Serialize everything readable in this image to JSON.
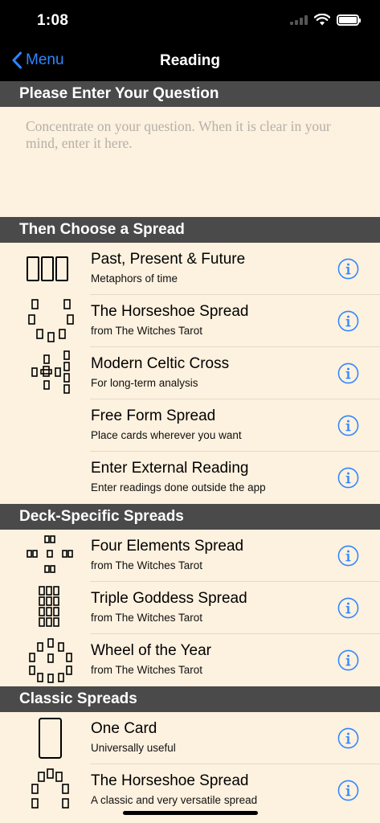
{
  "status_bar": {
    "time": "1:08"
  },
  "nav": {
    "back_label": "Menu",
    "title": "Reading"
  },
  "question": {
    "header": "Please Enter Your Question",
    "placeholder": "Concentrate on your question. When it is clear in your mind, enter it here."
  },
  "spread_section": {
    "header": "Then Choose a Spread",
    "items": [
      {
        "title": "Past, Present & Future",
        "subtitle": "Metaphors of time",
        "icon": "three-card-layout-icon"
      },
      {
        "title": "The Horseshoe Spread",
        "subtitle": "from The Witches Tarot",
        "icon": "horseshoe-layout-icon"
      },
      {
        "title": "Modern Celtic Cross",
        "subtitle": "For long-term analysis",
        "icon": "celtic-cross-layout-icon"
      },
      {
        "title": "Free Form Spread",
        "subtitle": "Place cards wherever you want",
        "icon": "none"
      },
      {
        "title": "Enter External Reading",
        "subtitle": "Enter readings done outside the app",
        "icon": "none"
      }
    ]
  },
  "deck_section": {
    "header": "Deck-Specific Spreads",
    "items": [
      {
        "title": "Four Elements Spread",
        "subtitle": "from The Witches Tarot",
        "icon": "four-elements-layout-icon"
      },
      {
        "title": "Triple Goddess Spread",
        "subtitle": "from The Witches Tarot",
        "icon": "triple-goddess-layout-icon"
      },
      {
        "title": "Wheel of the Year",
        "subtitle": "from The Witches Tarot",
        "icon": "wheel-layout-icon"
      }
    ]
  },
  "classic_section": {
    "header": "Classic Spreads",
    "items": [
      {
        "title": "One Card",
        "subtitle": "Universally useful",
        "icon": "single-card-icon"
      },
      {
        "title": "The Horseshoe Spread",
        "subtitle": "A classic and very versatile spread",
        "icon": "horseshoe-layout-icon"
      }
    ]
  },
  "colors": {
    "accent": "#2f86ff",
    "section_header_bg": "#4a4a4a",
    "content_bg": "#fdf1df"
  }
}
